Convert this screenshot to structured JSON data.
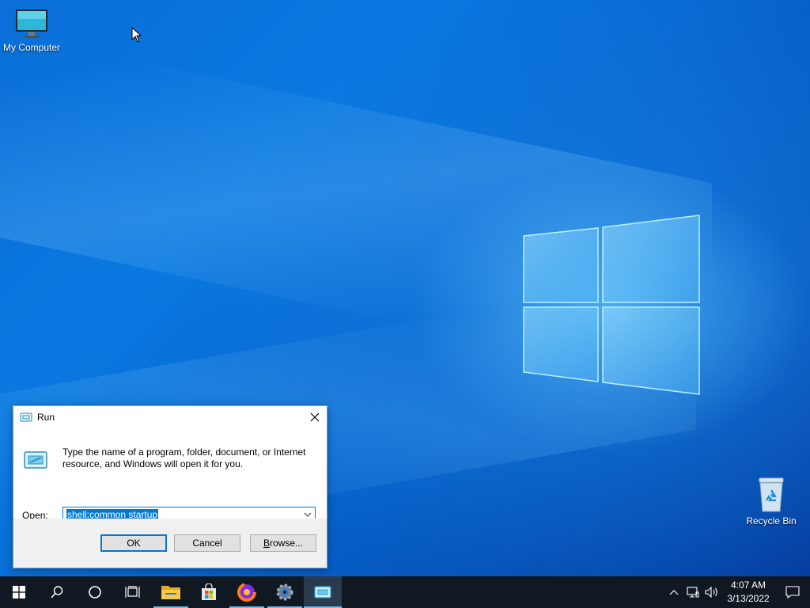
{
  "desktop": {
    "icons": [
      {
        "label": "My Computer",
        "icon": "computer-icon"
      },
      {
        "label": "Recycle Bin",
        "icon": "recycle-bin-icon"
      }
    ]
  },
  "run_dialog": {
    "title": "Run",
    "description": "Type the name of a program, folder, document, or Internet resource, and Windows will open it for you.",
    "open_label_prefix": "",
    "open_label_accel": "O",
    "open_label_rest": "pen:",
    "open_value": "shell:common startup",
    "ok_label": "OK",
    "cancel_label": "Cancel",
    "browse_accel": "B",
    "browse_rest": "rowse..."
  },
  "taskbar": {
    "items": [
      "start-icon",
      "search-icon",
      "cortana-icon",
      "task-view-icon",
      "file-explorer-icon",
      "store-icon",
      "firefox-icon",
      "settings-icon",
      "run-app-icon"
    ],
    "clock": {
      "time": "4:07 AM",
      "date": "3/13/2022"
    },
    "tray": [
      "chevron-up-icon",
      "network-icon",
      "volume-icon",
      "notifications-icon"
    ]
  },
  "colors": {
    "accent": "#0078d7",
    "taskbar": "#101822"
  }
}
